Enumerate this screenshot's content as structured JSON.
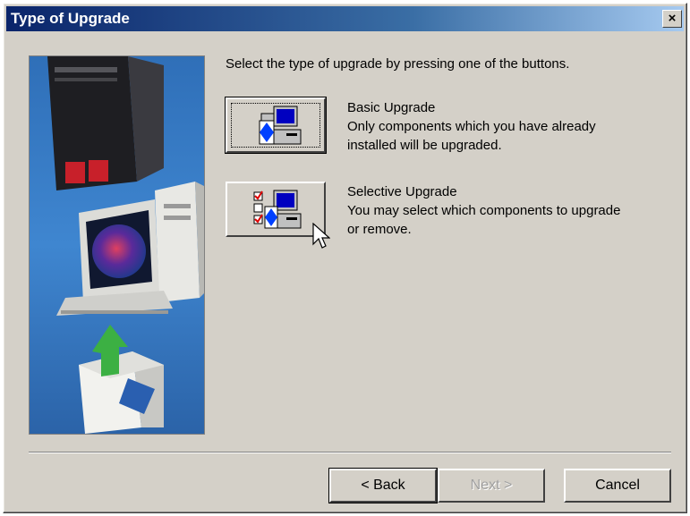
{
  "window": {
    "title": "Type of Upgrade"
  },
  "titlebar": {
    "close_glyph": "×",
    "close_icon": "close-icon"
  },
  "instruction": "Select the type of upgrade by pressing one of the buttons.",
  "options": [
    {
      "title": "Basic Upgrade",
      "desc1": "Only components which you have already",
      "desc2": "installed will be upgraded.",
      "icon": "computer-install-icon"
    },
    {
      "title": "Selective Upgrade",
      "desc1": "You may select which components to upgrade",
      "desc2": "or remove.",
      "icon": "computer-checklist-icon"
    }
  ],
  "buttons": {
    "back": "< Back",
    "next": "Next >",
    "cancel": "Cancel"
  },
  "colors": {
    "titlebar_start": "#0a246a",
    "titlebar_end": "#a6caf0",
    "dialog_bg": "#d4d0c8"
  }
}
